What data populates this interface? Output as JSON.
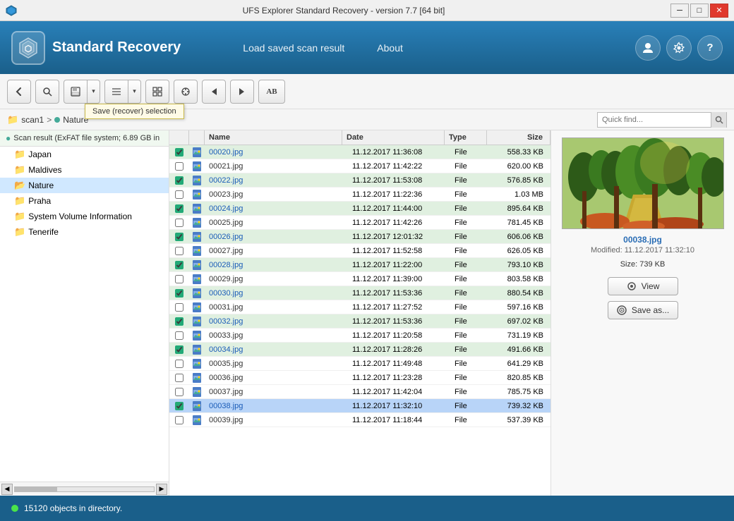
{
  "window": {
    "title": "UFS Explorer Standard Recovery - version 7.7 [64 bit]",
    "min_btn": "─",
    "max_btn": "□",
    "close_btn": "✕"
  },
  "header": {
    "app_name": "Standard Recovery",
    "logo_symbol": "⬡",
    "nav": [
      {
        "label": "Load saved scan result",
        "id": "load-scan"
      },
      {
        "label": "About",
        "id": "about"
      }
    ],
    "user_icon": "👤",
    "settings_icon": "⚙",
    "help_icon": "?"
  },
  "toolbar": {
    "back_tooltip": "←",
    "search_tooltip": "🔍",
    "save_tooltip": "💾",
    "save_dropdown": "▾",
    "list_tooltip": "☰",
    "list_dropdown": "▾",
    "grid_tooltip": "⊞",
    "prev_tooltip": "◀",
    "next_tooltip": "▶",
    "scan_tooltip": "AB",
    "tooltip_text": "Save (recover) selection"
  },
  "breadcrumb": {
    "folder_icon": "📁",
    "items": [
      "scan1",
      "Nature"
    ],
    "search_placeholder": "Quick find..."
  },
  "scan_header": {
    "text": "Scan result (ExFAT file system; 6.89 GB in"
  },
  "tree": {
    "items": [
      {
        "name": "Japan",
        "indent": 1
      },
      {
        "name": "Maldives",
        "indent": 1
      },
      {
        "name": "Nature",
        "indent": 1,
        "selected": true
      },
      {
        "name": "Praha",
        "indent": 1
      },
      {
        "name": "System Volume Information",
        "indent": 1
      },
      {
        "name": "Tenerife",
        "indent": 1
      }
    ]
  },
  "file_list": {
    "headers": [
      "",
      "",
      "Name",
      "Date",
      "Type",
      "Size"
    ],
    "files": [
      {
        "name": "00020.jpg",
        "date": "11.12.2017 11:36:08",
        "type": "File",
        "size": "558.33 KB",
        "checked": true,
        "highlight": false
      },
      {
        "name": "00021.jpg",
        "date": "11.12.2017 11:42:22",
        "type": "File",
        "size": "620.00 KB",
        "checked": false,
        "highlight": false
      },
      {
        "name": "00022.jpg",
        "date": "11.12.2017 11:53:08",
        "type": "File",
        "size": "576.85 KB",
        "checked": true,
        "highlight": false
      },
      {
        "name": "00023.jpg",
        "date": "11.12.2017 11:22:36",
        "type": "File",
        "size": "1.03 MB",
        "checked": false,
        "highlight": false
      },
      {
        "name": "00024.jpg",
        "date": "11.12.2017 11:44:00",
        "type": "File",
        "size": "895.64 KB",
        "checked": true,
        "highlight": false
      },
      {
        "name": "00025.jpg",
        "date": "11.12.2017 11:42:26",
        "type": "File",
        "size": "781.45 KB",
        "checked": false,
        "highlight": false
      },
      {
        "name": "00026.jpg",
        "date": "11.12.2017 12:01:32",
        "type": "File",
        "size": "606.06 KB",
        "checked": true,
        "highlight": false
      },
      {
        "name": "00027.jpg",
        "date": "11.12.2017 11:52:58",
        "type": "File",
        "size": "626.05 KB",
        "checked": false,
        "highlight": false
      },
      {
        "name": "00028.jpg",
        "date": "11.12.2017 11:22:00",
        "type": "File",
        "size": "793.10 KB",
        "checked": true,
        "highlight": false
      },
      {
        "name": "00029.jpg",
        "date": "11.12.2017 11:39:00",
        "type": "File",
        "size": "803.58 KB",
        "checked": false,
        "highlight": false
      },
      {
        "name": "00030.jpg",
        "date": "11.12.2017 11:53:36",
        "type": "File",
        "size": "880.54 KB",
        "checked": true,
        "highlight": false
      },
      {
        "name": "00031.jpg",
        "date": "11.12.2017 11:27:52",
        "type": "File",
        "size": "597.16 KB",
        "checked": false,
        "highlight": false
      },
      {
        "name": "00032.jpg",
        "date": "11.12.2017 11:53:36",
        "type": "File",
        "size": "697.02 KB",
        "checked": true,
        "highlight": false
      },
      {
        "name": "00033.jpg",
        "date": "11.12.2017 11:20:58",
        "type": "File",
        "size": "731.19 KB",
        "checked": false,
        "highlight": false
      },
      {
        "name": "00034.jpg",
        "date": "11.12.2017 11:28:26",
        "type": "File",
        "size": "491.66 KB",
        "checked": true,
        "highlight": false
      },
      {
        "name": "00035.jpg",
        "date": "11.12.2017 11:49:48",
        "type": "File",
        "size": "641.29 KB",
        "checked": false,
        "highlight": false
      },
      {
        "name": "00036.jpg",
        "date": "11.12.2017 11:23:28",
        "type": "File",
        "size": "820.85 KB",
        "checked": false,
        "highlight": false
      },
      {
        "name": "00037.jpg",
        "date": "11.12.2017 11:42:04",
        "type": "File",
        "size": "785.75 KB",
        "checked": false,
        "highlight": false
      },
      {
        "name": "00038.jpg",
        "date": "11.12.2017 11:32:10",
        "type": "File",
        "size": "739.32 KB",
        "checked": true,
        "highlight": true,
        "selected": true
      },
      {
        "name": "00039.jpg",
        "date": "11.12.2017 11:18:44",
        "type": "File",
        "size": "537.39 KB",
        "checked": false,
        "highlight": false
      }
    ]
  },
  "preview": {
    "filename": "00038.jpg",
    "modified_label": "Modified:",
    "modified": "11.12.2017 11:32:10",
    "size_label": "Size:",
    "size": "739 KB",
    "view_btn": "View",
    "save_btn": "Save as...",
    "view_icon": "👁",
    "save_icon": "💾"
  },
  "status": {
    "text": "15120 objects in directory."
  }
}
